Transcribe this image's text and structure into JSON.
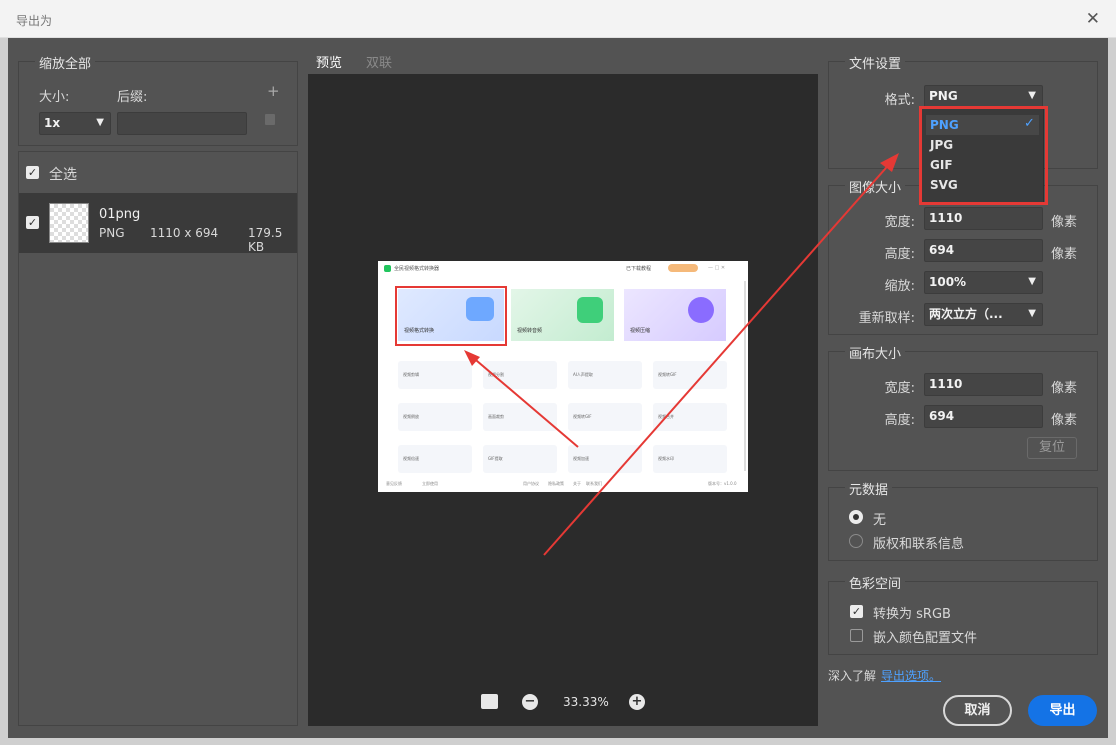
{
  "window": {
    "title": "导出为",
    "close_glyph": "✕"
  },
  "left": {
    "scale_all_title": "缩放全部",
    "size_label": "大小:",
    "suffix_label": "后缀:",
    "size_value": "1x",
    "suffix_value": "",
    "select_all_label": "全选",
    "file": {
      "name": "01png",
      "format": "PNG",
      "dimensions": "1110 x 694",
      "size": "179.5 KB"
    }
  },
  "center": {
    "tabs": [
      "预览",
      "双联"
    ],
    "active_tab": "预览",
    "zoom": "33.33%"
  },
  "preview_app": {
    "title": "全民视频格式转换器",
    "top_right_text": "已下载教程",
    "cards": [
      "视频格式转换",
      "视频转音频",
      "视频压缩"
    ],
    "tools": [
      [
        "视频剪辑",
        "视频分割",
        "AI人声提取",
        "视频转GIF"
      ],
      [
        "视频倒放",
        "画面裁剪",
        "视频转GIF",
        "视频合并"
      ],
      [
        "视频倍速",
        "GIF提取",
        "视频加速",
        "视频水印"
      ]
    ],
    "footer_left": [
      "意见反馈",
      "立即使用"
    ],
    "footer_links": [
      "用户协议",
      "隐私政策",
      "关于",
      "联系我们"
    ],
    "footer_version": "版本号：v1.0.0"
  },
  "right": {
    "file_settings_title": "文件设置",
    "format_label": "格式:",
    "format_value": "PNG",
    "format_options": [
      "PNG",
      "JPG",
      "GIF",
      "SVG"
    ],
    "image_size_title": "图像大小",
    "width_label": "宽度:",
    "width_value": "1110",
    "height_label": "高度:",
    "height_value": "694",
    "unit": "像素",
    "scale_label": "缩放:",
    "scale_value": "100%",
    "resample_label": "重新取样:",
    "resample_value": "两次立方（...",
    "canvas_size_title": "画布大小",
    "canvas_width_label": "宽度:",
    "canvas_width_value": "1110",
    "canvas_height_label": "高度:",
    "canvas_height_value": "694",
    "reset_label": "复位",
    "metadata_title": "元数据",
    "metadata_none": "无",
    "metadata_copyright": "版权和联系信息",
    "color_space_title": "色彩空间",
    "convert_srgb": "转换为 sRGB",
    "embed_profile": "嵌入颜色配置文件",
    "learn_more": "深入了解",
    "export_options_link": "导出选项。",
    "cancel": "取消",
    "export": "导出"
  },
  "colors": {
    "accent": "#1473e6",
    "annotation": "#e53935",
    "panel": "#535353",
    "canvas": "#2b2b2b"
  }
}
